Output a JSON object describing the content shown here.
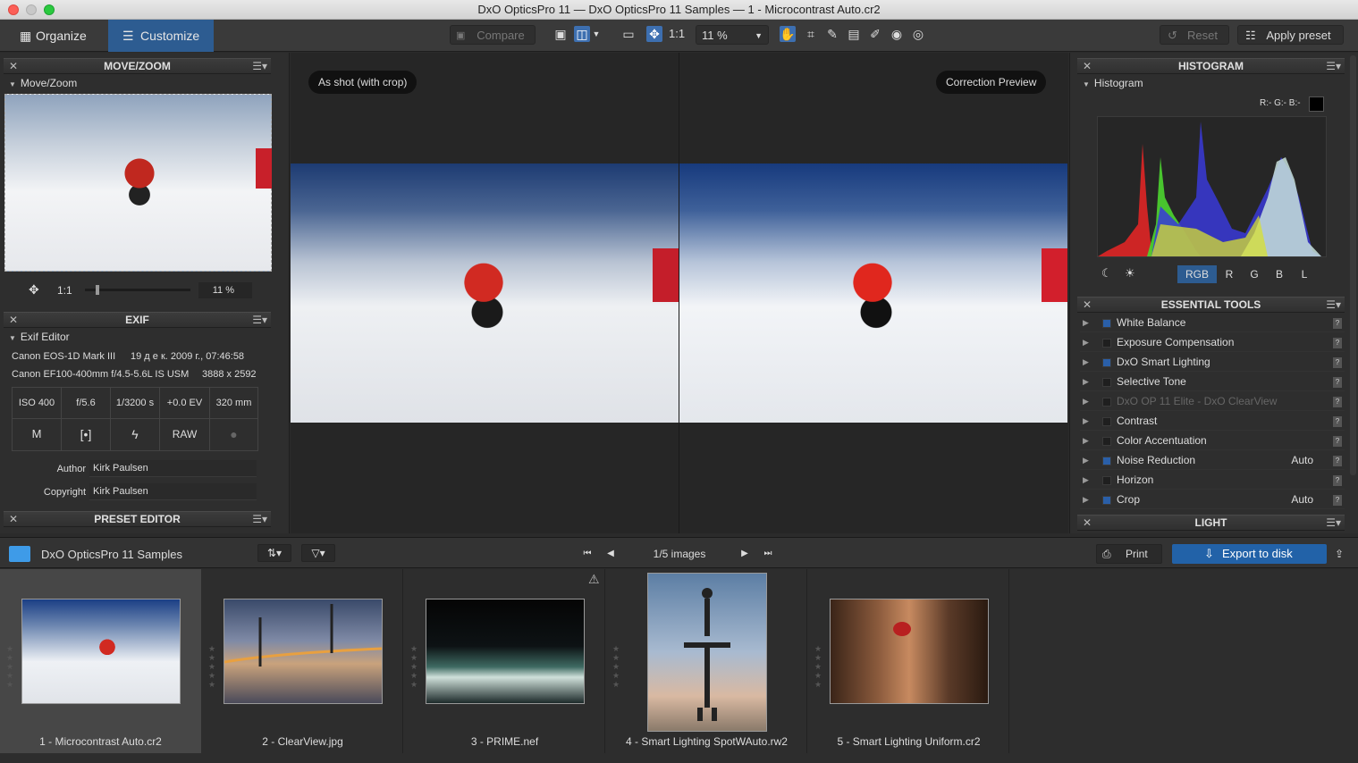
{
  "window": {
    "title": "DxO OpticsPro 11 — DxO OpticsPro 11 Samples — 1 - Microcontrast Auto.cr2"
  },
  "toolbar": {
    "organize": "Organize",
    "customize": "Customize",
    "compare": "Compare",
    "ratio": "1:1",
    "zoom": "11 %",
    "reset": "Reset",
    "apply_preset": "Apply preset"
  },
  "viewer": {
    "left_label": "As shot (with crop)",
    "right_label": "Correction Preview"
  },
  "movezoom": {
    "title": "MOVE/ZOOM",
    "sub": "Move/Zoom",
    "ratio": "1:1",
    "zoom": "11 %"
  },
  "exif": {
    "title": "EXIF",
    "sub": "Exif Editor",
    "camera": "Canon EOS-1D Mark III",
    "date": "19 д е к. 2009  г., 07:46:58",
    "lens": "Canon EF100-400mm f/4.5-5.6L IS USM",
    "size": "3888 x 2592",
    "iso": "ISO 400",
    "aperture": "f/5.6",
    "shutter": "1/3200 s",
    "ev": "+0.0 EV",
    "focal": "320 mm",
    "mode": "M",
    "raw": "RAW",
    "author_label": "Author",
    "author": "Kirk Paulsen",
    "copyright_label": "Copyright",
    "copyright": "Kirk Paulsen"
  },
  "preset_editor": {
    "title": "PRESET EDITOR"
  },
  "histogram": {
    "title": "HISTOGRAM",
    "sub": "Histogram",
    "rgb_readout": "R:- G:- B:-",
    "channels": [
      "RGB",
      "R",
      "G",
      "B",
      "L"
    ]
  },
  "essential": {
    "title": "ESSENTIAL TOOLS",
    "tools": [
      {
        "name": "White Balance",
        "active": true,
        "auto": ""
      },
      {
        "name": "Exposure Compensation",
        "active": false,
        "auto": ""
      },
      {
        "name": "DxO Smart Lighting",
        "active": true,
        "auto": ""
      },
      {
        "name": "Selective Tone",
        "active": false,
        "auto": ""
      },
      {
        "name": "DxO OP 11 Elite - DxO ClearView",
        "active": false,
        "auto": "",
        "disabled": true
      },
      {
        "name": "Contrast",
        "active": false,
        "auto": ""
      },
      {
        "name": "Color Accentuation",
        "active": false,
        "auto": ""
      },
      {
        "name": "Noise Reduction",
        "active": true,
        "auto": "Auto"
      },
      {
        "name": "Horizon",
        "active": false,
        "auto": ""
      },
      {
        "name": "Crop",
        "active": true,
        "auto": "Auto"
      }
    ]
  },
  "light": {
    "title": "LIGHT"
  },
  "browser": {
    "folder": "DxO OpticsPro 11 Samples",
    "count": "1/5 images",
    "print": "Print",
    "export": "Export to disk"
  },
  "thumbs": [
    {
      "caption": "1 - Microcontrast Auto.cr2"
    },
    {
      "caption": "2 - ClearView.jpg"
    },
    {
      "caption": "3 - PRIME.nef"
    },
    {
      "caption": "4 - Smart Lighting SpotWAuto.rw2"
    },
    {
      "caption": "5 - Smart Lighting Uniform.cr2"
    }
  ]
}
